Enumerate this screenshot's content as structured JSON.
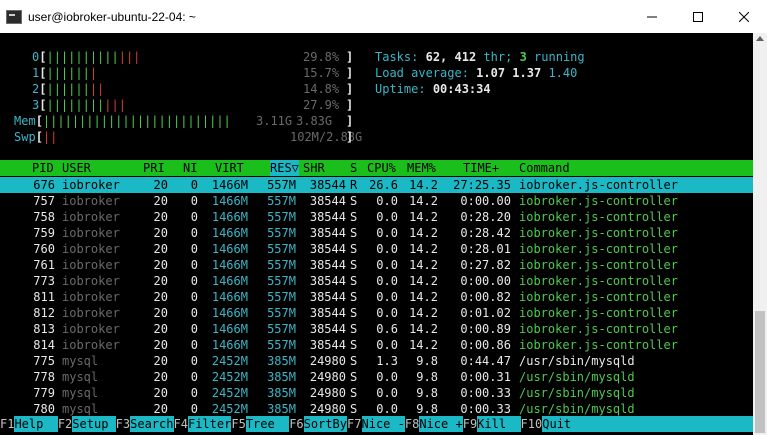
{
  "window": {
    "title": "user@iobroker-ubuntu-22-04: ~",
    "minimize_icon": "minimize-icon",
    "maximize_icon": "maximize-icon",
    "close_icon": "close-icon"
  },
  "cpus": [
    {
      "label": "0",
      "bars_green": "||||||||||",
      "bars_red": "|||",
      "percent": "29.8%"
    },
    {
      "label": "1",
      "bars_green": "||||||",
      "bars_red": "|",
      "percent": "15.7%"
    },
    {
      "label": "2",
      "bars_green": "||||||",
      "bars_red": "||",
      "percent": "14.8%"
    },
    {
      "label": "3",
      "bars_green": "||||||||",
      "bars_red": "|||",
      "percent": "27.9%"
    }
  ],
  "mem": {
    "label": "Mem",
    "bars": "||||||||||||||||||||||||||",
    "used": "3.11G",
    "total": "3.83G"
  },
  "swp": {
    "label": "Swp",
    "bars": "||",
    "used": "102M",
    "total": "2.88G"
  },
  "summary": {
    "tasks_label": "Tasks:",
    "tasks": "62,",
    "threads": "412",
    "threads_label": "thr;",
    "running": "3",
    "running_label": "running",
    "load_label": "Load average:",
    "load1": "1.07",
    "load5": "1.37",
    "load15": "1.40",
    "uptime_label": "Uptime:",
    "uptime": "00:43:34"
  },
  "columns": [
    "PID",
    "USER",
    "PRI",
    "NI",
    "VIRT",
    "RES▽",
    "SHR",
    "S",
    "CPU%",
    "MEM%",
    "TIME+",
    "Command"
  ],
  "processes": [
    {
      "pid": "676",
      "user": "iobroker",
      "pri": "20",
      "ni": "0",
      "virt": "1466M",
      "res": "557M",
      "shr": "38544",
      "s": "R",
      "cpu": "26.6",
      "mem": "14.2",
      "time": "27:25.35",
      "cmd": "iobroker.js-controller"
    },
    {
      "pid": "757",
      "user": "iobroker",
      "pri": "20",
      "ni": "0",
      "virt": "1466M",
      "res": "557M",
      "shr": "38544",
      "s": "S",
      "cpu": "0.0",
      "mem": "14.2",
      "time": "0:00.00",
      "cmd": "iobroker.js-controller"
    },
    {
      "pid": "758",
      "user": "iobroker",
      "pri": "20",
      "ni": "0",
      "virt": "1466M",
      "res": "557M",
      "shr": "38544",
      "s": "S",
      "cpu": "0.0",
      "mem": "14.2",
      "time": "0:28.20",
      "cmd": "iobroker.js-controller"
    },
    {
      "pid": "759",
      "user": "iobroker",
      "pri": "20",
      "ni": "0",
      "virt": "1466M",
      "res": "557M",
      "shr": "38544",
      "s": "S",
      "cpu": "0.0",
      "mem": "14.2",
      "time": "0:28.42",
      "cmd": "iobroker.js-controller"
    },
    {
      "pid": "760",
      "user": "iobroker",
      "pri": "20",
      "ni": "0",
      "virt": "1466M",
      "res": "557M",
      "shr": "38544",
      "s": "S",
      "cpu": "0.0",
      "mem": "14.2",
      "time": "0:28.01",
      "cmd": "iobroker.js-controller"
    },
    {
      "pid": "761",
      "user": "iobroker",
      "pri": "20",
      "ni": "0",
      "virt": "1466M",
      "res": "557M",
      "shr": "38544",
      "s": "S",
      "cpu": "0.0",
      "mem": "14.2",
      "time": "0:27.82",
      "cmd": "iobroker.js-controller"
    },
    {
      "pid": "773",
      "user": "iobroker",
      "pri": "20",
      "ni": "0",
      "virt": "1466M",
      "res": "557M",
      "shr": "38544",
      "s": "S",
      "cpu": "0.0",
      "mem": "14.2",
      "time": "0:00.00",
      "cmd": "iobroker.js-controller"
    },
    {
      "pid": "811",
      "user": "iobroker",
      "pri": "20",
      "ni": "0",
      "virt": "1466M",
      "res": "557M",
      "shr": "38544",
      "s": "S",
      "cpu": "0.0",
      "mem": "14.2",
      "time": "0:00.82",
      "cmd": "iobroker.js-controller"
    },
    {
      "pid": "812",
      "user": "iobroker",
      "pri": "20",
      "ni": "0",
      "virt": "1466M",
      "res": "557M",
      "shr": "38544",
      "s": "S",
      "cpu": "0.0",
      "mem": "14.2",
      "time": "0:01.02",
      "cmd": "iobroker.js-controller"
    },
    {
      "pid": "813",
      "user": "iobroker",
      "pri": "20",
      "ni": "0",
      "virt": "1466M",
      "res": "557M",
      "shr": "38544",
      "s": "S",
      "cpu": "0.6",
      "mem": "14.2",
      "time": "0:00.89",
      "cmd": "iobroker.js-controller"
    },
    {
      "pid": "814",
      "user": "iobroker",
      "pri": "20",
      "ni": "0",
      "virt": "1466M",
      "res": "557M",
      "shr": "38544",
      "s": "S",
      "cpu": "0.0",
      "mem": "14.2",
      "time": "0:00.86",
      "cmd": "iobroker.js-controller"
    },
    {
      "pid": "775",
      "user": "mysql",
      "pri": "20",
      "ni": "0",
      "virt": "2452M",
      "res": "385M",
      "shr": "24980",
      "s": "S",
      "cpu": "1.3",
      "mem": "9.8",
      "time": "0:44.47",
      "cmd": "/usr/sbin/mysqld"
    },
    {
      "pid": "778",
      "user": "mysql",
      "pri": "20",
      "ni": "0",
      "virt": "2452M",
      "res": "385M",
      "shr": "24980",
      "s": "S",
      "cpu": "0.0",
      "mem": "9.8",
      "time": "0:00.31",
      "cmd": "/usr/sbin/mysqld"
    },
    {
      "pid": "779",
      "user": "mysql",
      "pri": "20",
      "ni": "0",
      "virt": "2452M",
      "res": "385M",
      "shr": "24980",
      "s": "S",
      "cpu": "0.0",
      "mem": "9.8",
      "time": "0:00.33",
      "cmd": "/usr/sbin/mysqld"
    },
    {
      "pid": "780",
      "user": "mysql",
      "pri": "20",
      "ni": "0",
      "virt": "2452M",
      "res": "385M",
      "shr": "24980",
      "s": "S",
      "cpu": "0.0",
      "mem": "9.8",
      "time": "0:00.33",
      "cmd": "/usr/sbin/mysqld"
    }
  ],
  "footer": [
    {
      "key": "F1",
      "label": "Help"
    },
    {
      "key": "F2",
      "label": "Setup"
    },
    {
      "key": "F3",
      "label": "Search"
    },
    {
      "key": "F4",
      "label": "Filter"
    },
    {
      "key": "F5",
      "label": "Tree"
    },
    {
      "key": "F6",
      "label": "SortBy"
    },
    {
      "key": "F7",
      "label": "Nice -"
    },
    {
      "key": "F8",
      "label": "Nice +"
    },
    {
      "key": "F9",
      "label": "Kill"
    },
    {
      "key": "F10",
      "label": "Quit"
    }
  ],
  "colors": {
    "header_bg": "#1bbf1b",
    "selected_bg": "#1bb8c6",
    "cyan": "#3ab6c8",
    "green": "#4ec94e",
    "red": "#d43a3a"
  }
}
